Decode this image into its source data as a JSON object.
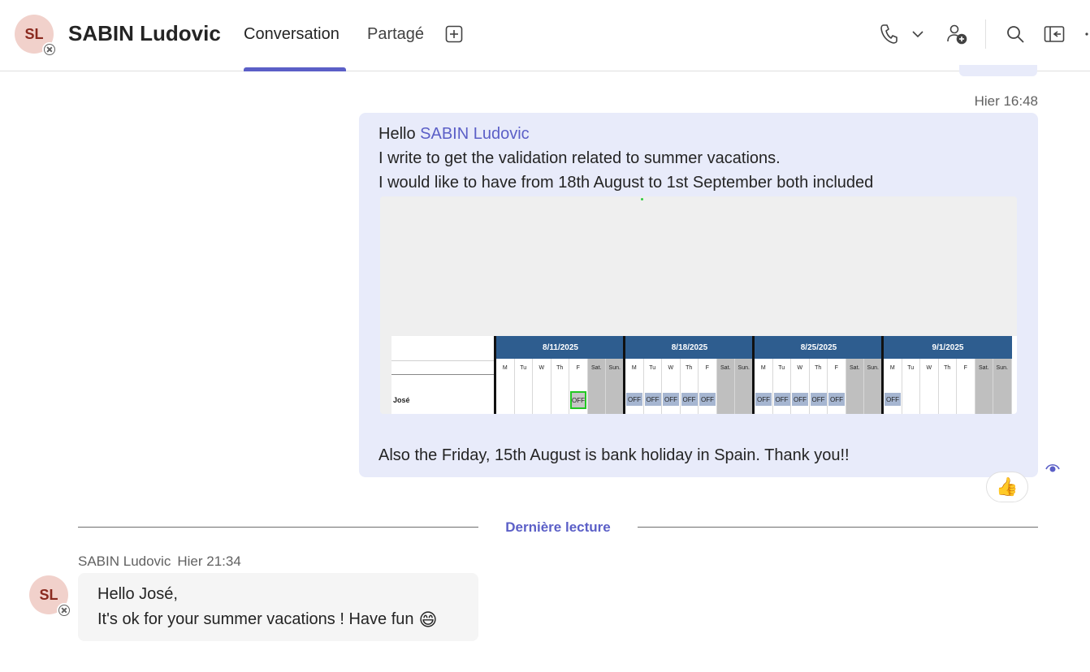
{
  "header": {
    "avatar_initials": "SL",
    "contact_name": "SABIN Ludovic",
    "tabs": [
      {
        "label": "Conversation",
        "active": true
      },
      {
        "label": "Partagé",
        "active": false
      }
    ],
    "icons": [
      "add-tab-icon",
      "phone-icon",
      "chevron-down-icon",
      "add-people-icon",
      "search-icon",
      "popout-icon",
      "more-icon"
    ],
    "accent_color": "#5b5fc7"
  },
  "message_sent": {
    "timestamp": "Hier 16:48",
    "greeting": "Hello ",
    "mention": "SABIN Ludovic",
    "line2": "I write to get the validation related to summer vacations.",
    "line3": "I would like to have from 18th August to 1st September both included",
    "line4": "Also the Friday, 15th August is bank holiday in Spain. Thank you!!",
    "bubble_color": "#e8ebfa",
    "attachment": {
      "employee_name": "José",
      "weeks": [
        {
          "date": "8/11/2025",
          "days": [
            "M",
            "Tu",
            "W",
            "Th",
            "F",
            "Sat.",
            "Sun."
          ],
          "off": [
            "F"
          ]
        },
        {
          "date": "8/18/2025",
          "days": [
            "M",
            "Tu",
            "W",
            "Th",
            "F",
            "Sat.",
            "Sun."
          ],
          "off": [
            "M",
            "Tu",
            "W",
            "Th",
            "F"
          ]
        },
        {
          "date": "8/25/2025",
          "days": [
            "M",
            "Tu",
            "W",
            "Th",
            "F",
            "Sat.",
            "Sun."
          ],
          "off": [
            "M",
            "Tu",
            "W",
            "Th",
            "F"
          ]
        },
        {
          "date": "9/1/2025",
          "days": [
            "M",
            "Tu",
            "W",
            "Th",
            "F",
            "Sat.",
            "Sun."
          ],
          "off": [
            "M"
          ]
        }
      ],
      "off_label": "OFF"
    },
    "reaction": "👍"
  },
  "divider": {
    "label": "Dernière lecture"
  },
  "message_received": {
    "avatar_initials": "SL",
    "sender": "SABIN Ludovic",
    "timestamp": "Hier 21:34",
    "line1": "Hello José,",
    "line2": "It's ok for your summer vacations ! Have fun",
    "emoji": "😄"
  }
}
